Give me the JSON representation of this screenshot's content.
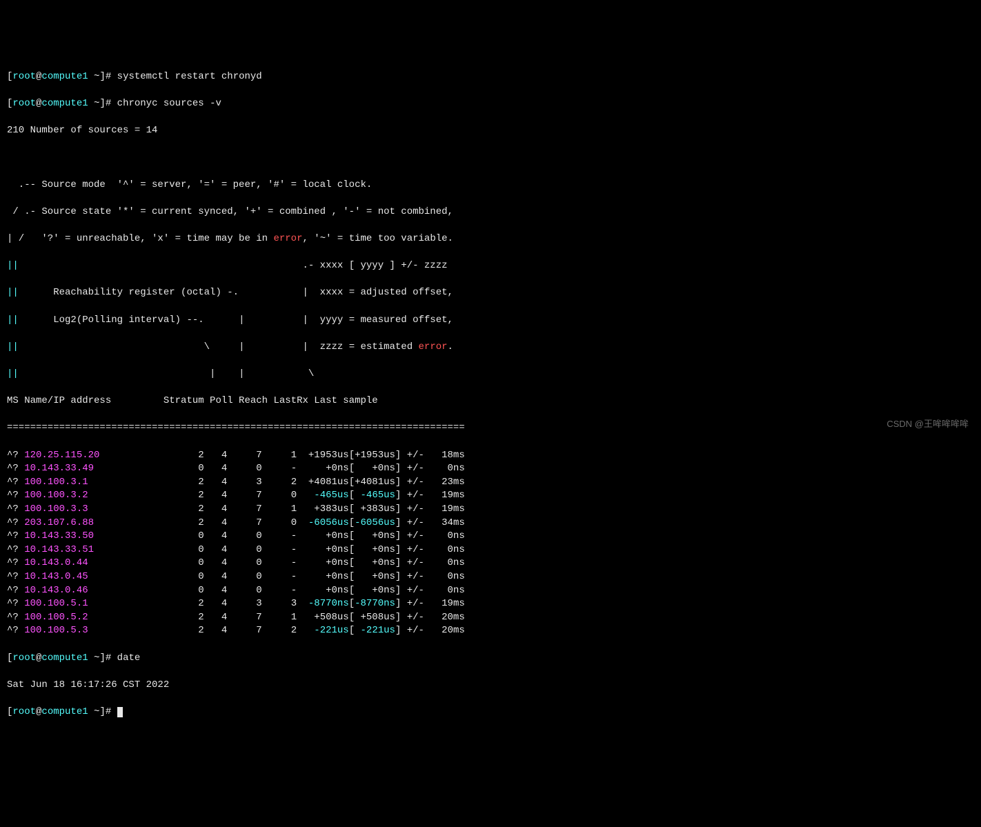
{
  "prompt": {
    "user": "root",
    "at": "@",
    "host": "compute1",
    "path": "~",
    "marker": "#"
  },
  "cmd1": "systemctl restart chronyd",
  "cmd2": "chronyc sources ",
  "cmd2_flag": "-v",
  "cmd3": "date",
  "date_output": "Sat Jun 18 16:17:26 CST 2022",
  "summary": "210 Number of sources = 14",
  "legend": {
    "l1": "  .-- Source mode  '^' = server, '=' = peer, '#' = local clock.",
    "l2": " / .- Source state '*' = current synced, '+' = combined , '-' = not combined,",
    "l3a": "| /   '?' = unreachable, 'x' = time may be in ",
    "l3b": "error",
    "l3c": ", '~' = time too variable.",
    "l4a": "||",
    "l4b": "                                                 .- xxxx [ yyyy ] +/- zzzz",
    "l5a": "||",
    "l5b": "      Reachability register (octal) -.           |  xxxx = adjusted offset,",
    "l6a": "||",
    "l6b": "      Log2(Polling interval) --.      |          |  yyyy = measured offset,",
    "l7a": "||",
    "l7b": "                                \\     |          |  zzzz = estimated ",
    "l7c": "error",
    "l7d": ".",
    "l8a": "||",
    "l8b": "                                 |    |           \\"
  },
  "header": "MS Name/IP address         Stratum Poll Reach LastRx Last sample",
  "divider": "===============================================================================",
  "rows": [
    {
      "ms": "^? ",
      "ip": "120.25.115.20",
      "rest": "                 2   4     7     1  +1953us[+1953us] +/-   18ms"
    },
    {
      "ms": "^? ",
      "ip": "10.143.33.49",
      "rest": "                  0   4     0     -     +0ns[   +0ns] +/-    0ns"
    },
    {
      "ms": "^? ",
      "ip": "100.100.3.1",
      "rest": "                   2   4     3     2  +4081us[+4081us] +/-   23ms"
    },
    {
      "ms": "^? ",
      "ip": "100.100.3.2",
      "rest": "                   2   4     7     0   ",
      "neg1": "-465us",
      "mid": "[ ",
      "neg2": "-465us",
      "end": "] +/-   19ms"
    },
    {
      "ms": "^? ",
      "ip": "100.100.3.3",
      "rest": "                   2   4     7     1   +383us[ +383us] +/-   19ms"
    },
    {
      "ms": "^? ",
      "ip": "203.107.6.88",
      "rest": "                  2   4     7     0  ",
      "neg1": "-6056us",
      "mid": "[",
      "neg2": "-6056us",
      "end": "] +/-   34ms"
    },
    {
      "ms": "^? ",
      "ip": "10.143.33.50",
      "rest": "                  0   4     0     -     +0ns[   +0ns] +/-    0ns"
    },
    {
      "ms": "^? ",
      "ip": "10.143.33.51",
      "rest": "                  0   4     0     -     +0ns[   +0ns] +/-    0ns"
    },
    {
      "ms": "^? ",
      "ip": "10.143.0.44",
      "rest": "                   0   4     0     -     +0ns[   +0ns] +/-    0ns"
    },
    {
      "ms": "^? ",
      "ip": "10.143.0.45",
      "rest": "                   0   4     0     -     +0ns[   +0ns] +/-    0ns"
    },
    {
      "ms": "^? ",
      "ip": "10.143.0.46",
      "rest": "                   0   4     0     -     +0ns[   +0ns] +/-    0ns"
    },
    {
      "ms": "^? ",
      "ip": "100.100.5.1",
      "rest": "                   2   4     3     3  ",
      "neg1": "-8770ns",
      "mid": "[",
      "neg2": "-8770ns",
      "end": "] +/-   19ms"
    },
    {
      "ms": "^? ",
      "ip": "100.100.5.2",
      "rest": "                   2   4     7     1   +508us[ +508us] +/-   20ms"
    },
    {
      "ms": "^? ",
      "ip": "100.100.5.3",
      "rest": "                   2   4     7     2   ",
      "neg1": "-221us",
      "mid": "[ ",
      "neg2": "-221us",
      "end": "] +/-   20ms"
    }
  ],
  "watermark": "CSDN @王哞哞哞哞"
}
